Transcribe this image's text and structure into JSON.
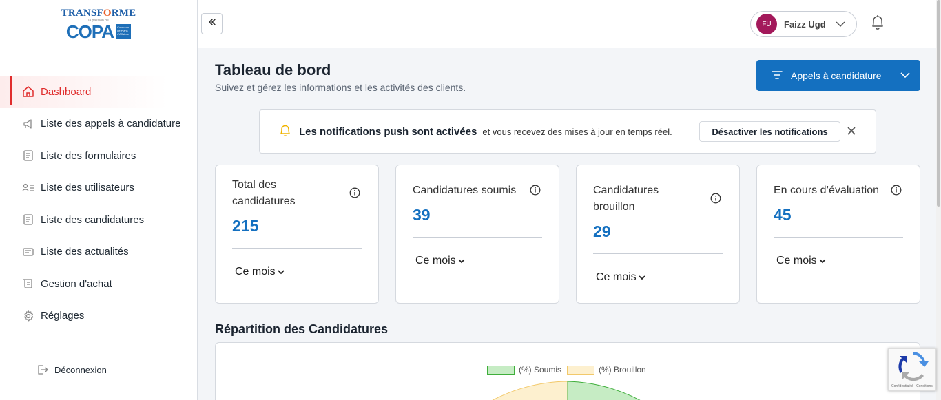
{
  "brand": {
    "top": "TRANSFORME",
    "tagline": "la passion de",
    "bottom": "COPA",
    "box": "Concours de Plans d'Affaires"
  },
  "sidebar": {
    "items": [
      {
        "label": "Dashboard",
        "icon": "home-icon",
        "active": true
      },
      {
        "label": "Liste des appels à candidature",
        "icon": "megaphone-icon"
      },
      {
        "label": "Liste des formulaires",
        "icon": "form-icon"
      },
      {
        "label": "Liste des utilisateurs",
        "icon": "users-list-icon"
      },
      {
        "label": "Liste des candidatures",
        "icon": "document-icon"
      },
      {
        "label": "Liste des actualités",
        "icon": "news-icon"
      },
      {
        "label": "Gestion d'achat",
        "icon": "scroll-icon"
      },
      {
        "label": "Réglages",
        "icon": "gear-icon"
      }
    ],
    "logout": "Déconnexion"
  },
  "header": {
    "user": {
      "initials": "FU",
      "name": "Faizz Ugd",
      "avatar_color": "#a3195b"
    }
  },
  "page": {
    "title": "Tableau de bord",
    "subtitle": "Suivez et gérez les informations et les activités des clients.",
    "filter_button": "Appels à candidature"
  },
  "notice": {
    "bold": "Les notifications push sont activées",
    "rest": "et vous recevez des mises à jour en temps réel.",
    "button": "Désactiver les notifications"
  },
  "cards": [
    {
      "label": "Total des candidatures",
      "value": "215",
      "period": "Ce mois"
    },
    {
      "label": "Candidatures soumis",
      "value": "39",
      "period": "Ce mois"
    },
    {
      "label": "Candidatures brouillon",
      "value": "29",
      "period": "Ce mois"
    },
    {
      "label": "En cours d’évaluation",
      "value": "45",
      "period": "Ce mois"
    }
  ],
  "section": {
    "title": "Répartition des Candidatures"
  },
  "chart_data": {
    "type": "pie",
    "series": [
      {
        "name": "(%) Soumis",
        "color": "#c6ecc4",
        "border": "#3fae3b"
      },
      {
        "name": "(%) Brouillon",
        "color": "#fdf0cf",
        "border": "#f2c96b"
      }
    ]
  },
  "recaptcha": {
    "text": "Confidentialité - Conditions"
  },
  "colors": {
    "accent": "#1470c0",
    "active": "#e02d2d"
  }
}
